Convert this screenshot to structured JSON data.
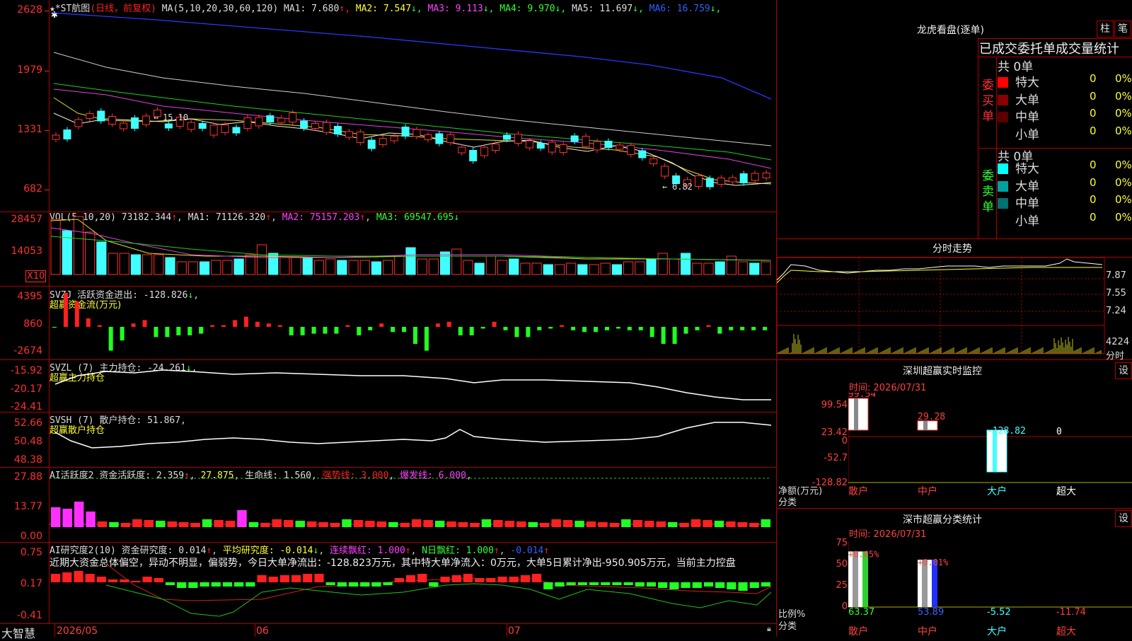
{
  "header": {
    "stars": "★*ST航图",
    "mode": "(日线，前复权)",
    "ma_label": "MA(5,10,20,30,60,120)",
    "ma": [
      {
        "name": "MA1",
        "value": "7.680",
        "arrow": "↑",
        "color": "#dddddd"
      },
      {
        "name": "MA2",
        "value": "7.547",
        "arrow": "↓",
        "color": "#ffff30"
      },
      {
        "name": "MA3",
        "value": "9.113",
        "arrow": "↓",
        "color": "#ff40ff"
      },
      {
        "name": "MA4",
        "value": "9.970",
        "arrow": "↓",
        "color": "#30ff30"
      },
      {
        "name": "MA5",
        "value": "11.697",
        "arrow": "↓",
        "color": "#dddddd"
      },
      {
        "name": "MA6",
        "value": "16.759",
        "arrow": "↓",
        "color": "#3060ff"
      }
    ],
    "high_note": "15.10",
    "low_note": "6.82"
  },
  "price_axis": [
    "2628",
    "1979",
    "1331",
    "682"
  ],
  "vol": {
    "label": "VOL(5,10,20)",
    "value": "73182.344",
    "ma1": "MA1: 71126.320",
    "ma2": "MA2: 75157.203",
    "ma3": "MA3: 69547.695",
    "axis": [
      "28457",
      "14053"
    ],
    "unit": "X10"
  },
  "svzj": {
    "line1": "SVZJ  活跃资金进出: -128.826",
    "line2": "超赢资金流(万元)",
    "axis": [
      "4395",
      "860",
      "-2674"
    ]
  },
  "svzl": {
    "line1": "SVZL (7) 主力持仓: -24.261",
    "line2": "超赢主力持仓",
    "axis": [
      "-15.92",
      "-20.17",
      "-24.41"
    ]
  },
  "svsh": {
    "line1": "SVSH (7) 散户持仓: 51.867",
    "line2": "超赢散户持仓",
    "axis": [
      "52.66",
      "50.48",
      "48.38"
    ]
  },
  "ai1": {
    "title": "AI活跃度2 资金活跃度: 2.359",
    "v2": "27.875",
    "life": "生命线: 1.560",
    "strong": "强势线: 3.000",
    "burst": "爆发线: 6.000",
    "axis": [
      "27.88",
      "13.77",
      "0.00"
    ]
  },
  "ai2": {
    "title": "AI研究度2(10) 资金研究度: 0.014",
    "avg": "平均研究度: -0.014",
    "cont": "连续飘红: 1.000",
    "nday": "N日飘红: 1.000",
    "last": "-0.014",
    "desc": "近期大资金总体偏空，异动不明显，偏弱势，今日大单净流出：-128.823万元，其中特大单净流入：0万元，大单5日累计净出-950.905万元，当前主力控盘",
    "axis": [
      "0.75",
      "0.17",
      "-0.41"
    ]
  },
  "bottom": {
    "brand": "大智慧",
    "dates": [
      "2026/05",
      "06",
      "07"
    ]
  },
  "right": {
    "title": "龙虎看盘(逐单)",
    "btn_zhu": "柱",
    "btn_bi": "笔",
    "tabs": "已成交委托单成交量统计",
    "buy": {
      "side": "委买单",
      "total": "共 0单",
      "rows": [
        {
          "label": "特大",
          "count": "0",
          "pct": "0%",
          "color": "#ff0000"
        },
        {
          "label": "大单",
          "count": "0",
          "pct": "0%",
          "color": "#8a0000"
        },
        {
          "label": "中单",
          "count": "0",
          "pct": "0%",
          "color": "#5a0000"
        },
        {
          "label": "小单",
          "count": "0",
          "pct": "0%",
          "color": "#000000"
        }
      ]
    },
    "sell": {
      "side": "委卖单",
      "total": "共 0单",
      "rows": [
        {
          "label": "特大",
          "count": "0",
          "pct": "0%",
          "color": "#00ffff"
        },
        {
          "label": "大单",
          "count": "0",
          "pct": "0%",
          "color": "#00a0a0"
        },
        {
          "label": "中单",
          "count": "0",
          "pct": "0%",
          "color": "#007070"
        },
        {
          "label": "小单",
          "count": "0",
          "pct": "0%",
          "color": "#000000"
        }
      ]
    },
    "intraday": {
      "title": "分时走势",
      "axis": [
        "7.87",
        "7.55",
        "7.24"
      ],
      "vol_axis": "4224",
      "vol_unit": "分时"
    },
    "monitor": {
      "title": "深圳超赢实时监控",
      "btn": "设",
      "time": "时间: 2026/07/31",
      "axis": [
        "99.54",
        "23.42",
        "0",
        "-52.7",
        "-128.82"
      ],
      "y_label": "净额(万元)",
      "x_label": "分类",
      "categories": [
        "散户",
        "中户",
        "大户",
        "超大"
      ],
      "values": [
        "99.54",
        "29.28",
        "-128.82",
        "0"
      ]
    },
    "classify": {
      "title": "深市超赢分类统计",
      "btn": "设",
      "time": "时间: 2026/07/31",
      "axis": [
        "75",
        "50",
        "25",
        "0"
      ],
      "y_label": "比例%",
      "x_label": "分类",
      "categories": [
        "散户",
        "中户",
        "大户",
        "超大"
      ],
      "top_values": [
        "+0.05%",
        "+0.01%"
      ],
      "bottom_values": [
        "63.37",
        "53.89",
        "-5.52",
        "-11.74"
      ]
    }
  },
  "chart_data": [
    {
      "type": "bar",
      "title": "深圳超赢实时监控",
      "ylabel": "净额(万元)",
      "xlabel": "分类",
      "categories": [
        "散户",
        "中户",
        "大户",
        "超大"
      ],
      "values": [
        99.54,
        29.28,
        -128.82,
        0
      ],
      "ylim": [
        -128.82,
        99.54
      ]
    },
    {
      "type": "bar",
      "title": "深市超赢分类统计",
      "ylabel": "比例%",
      "xlabel": "分类",
      "categories": [
        "散户",
        "中户",
        "大户",
        "超大"
      ],
      "values": [
        63.37,
        53.89,
        -5.52,
        -11.74
      ],
      "ylim": [
        0,
        75
      ]
    }
  ]
}
